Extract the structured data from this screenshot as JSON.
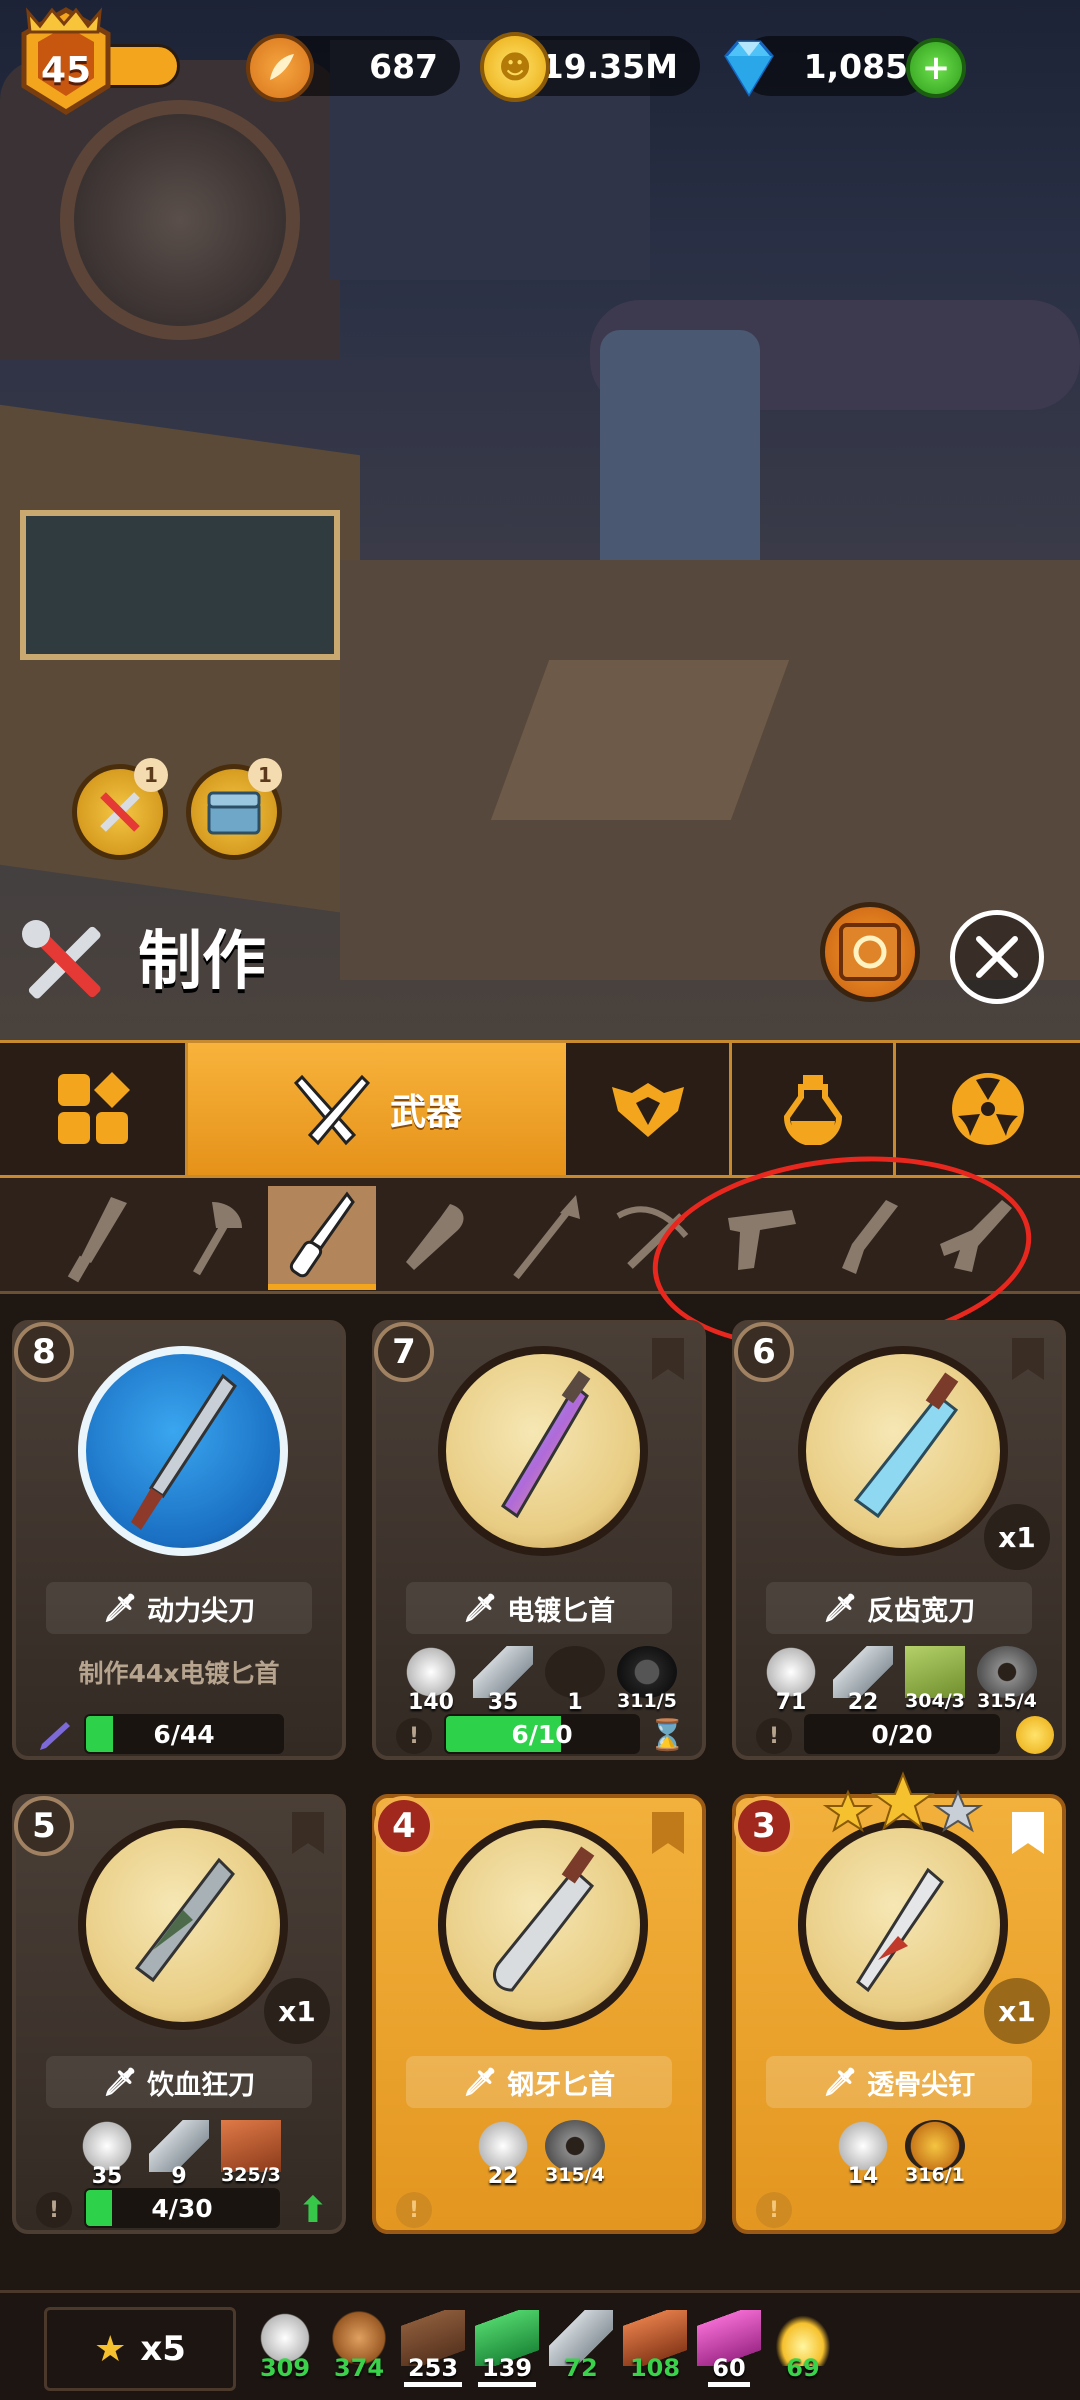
{
  "header": {
    "level": "45",
    "feathers": "687",
    "coins": "19.35M",
    "gems": "1,085"
  },
  "scene": {
    "notif_tools": "1",
    "notif_chest": "1"
  },
  "title": "制作",
  "tabs": [
    {
      "id": "all",
      "label": ""
    },
    {
      "id": "weapons",
      "label": "武器"
    },
    {
      "id": "armor",
      "label": ""
    },
    {
      "id": "potions",
      "label": ""
    },
    {
      "id": "radiation",
      "label": ""
    }
  ],
  "subtabs": [
    "machete",
    "axe",
    "knife",
    "club",
    "spear",
    "crossbow",
    "pistol",
    "shotgun",
    "rifle"
  ],
  "cards": [
    {
      "rank": "8",
      "name": "动力尖刀",
      "desc": "制作44x电镀匕首",
      "progress": "6/44",
      "fill": 0.136
    },
    {
      "rank": "7",
      "name": "电镀匕首",
      "mats": [
        "140",
        "35",
        "1",
        "311/5"
      ],
      "progress": "6/10",
      "fill": 0.6
    },
    {
      "rank": "6",
      "name": "反齿宽刀",
      "count": "x1",
      "mats": [
        "71",
        "22",
        "304/3",
        "315/4"
      ],
      "progress": "0/20",
      "fill": 0
    },
    {
      "rank": "5",
      "name": "饮血狂刀",
      "count": "x1",
      "mats": [
        "35",
        "9",
        "325/3"
      ],
      "progress": "4/30",
      "fill": 0.133
    },
    {
      "rank": "4",
      "name": "钢牙匕首",
      "mats": [
        "22",
        "315/4"
      ]
    },
    {
      "rank": "3",
      "name": "透骨尖钉",
      "count": "x1",
      "mats": [
        "14",
        "316/1"
      ]
    }
  ],
  "bottom": {
    "stars": "x5",
    "resources": [
      {
        "value": "309",
        "color": "#39d24a"
      },
      {
        "value": "374",
        "color": "#39d24a"
      },
      {
        "value": "253",
        "color": "#ffffff"
      },
      {
        "value": "139",
        "color": "#ffffff"
      },
      {
        "value": "72",
        "color": "#39d24a"
      },
      {
        "value": "108",
        "color": "#39d24a"
      },
      {
        "value": "60",
        "color": "#ffffff"
      },
      {
        "value": "69",
        "color": "#39d24a"
      }
    ]
  }
}
